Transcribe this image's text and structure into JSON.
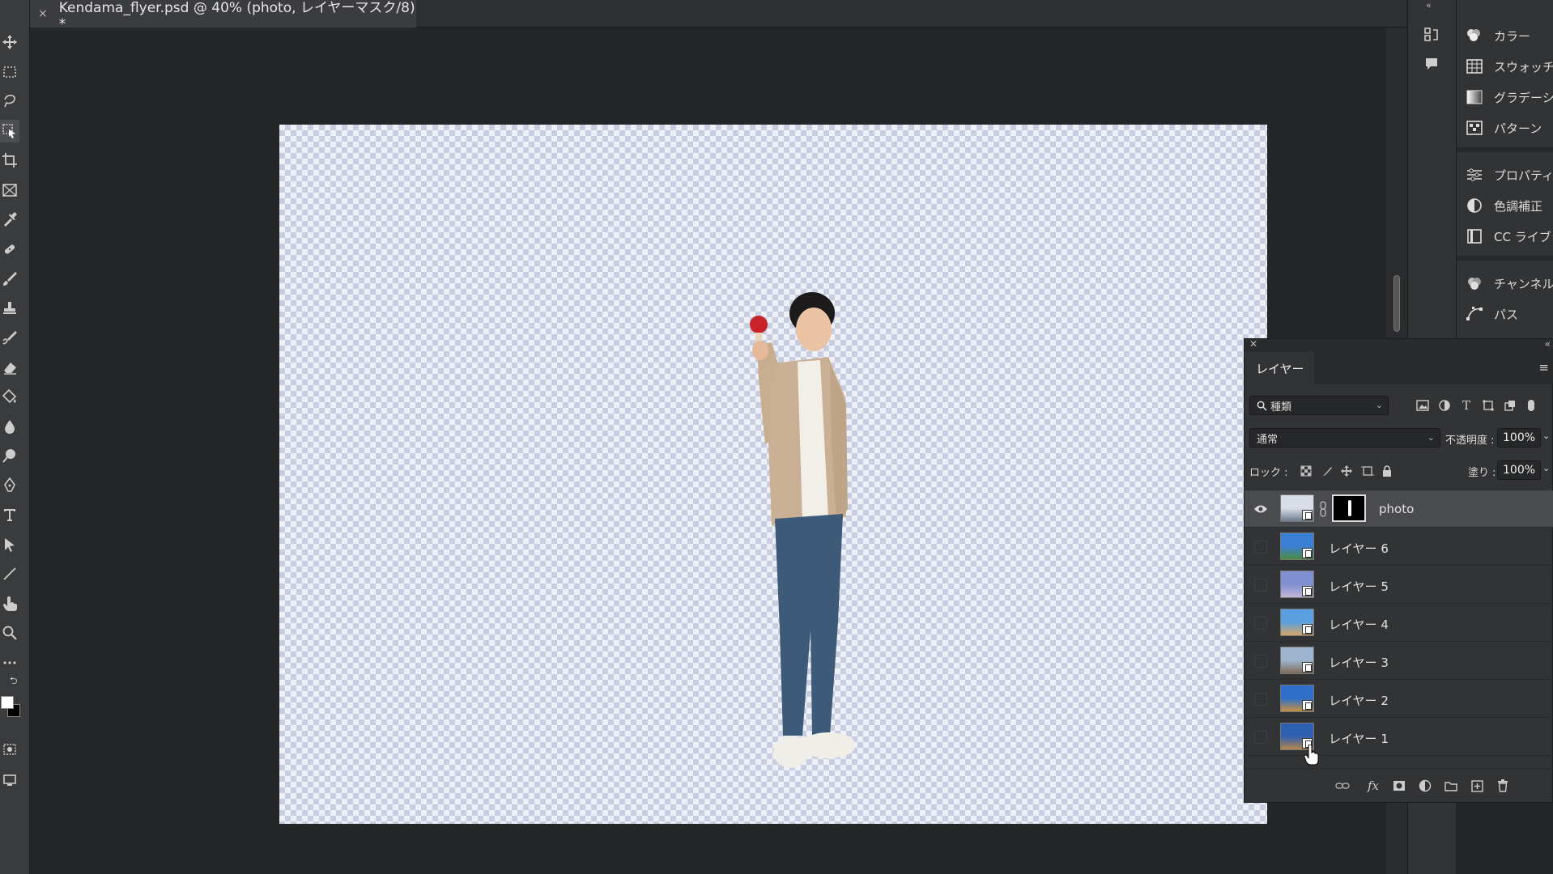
{
  "document_tab": {
    "close_glyph": "×",
    "title": "Kendama_flyer.psd @ 40% (photo, レイヤーマスク/8) *"
  },
  "toolbar": {
    "tools": [
      "move-tool-icon",
      "marquee-tool-icon",
      "lasso-tool-icon",
      "object-select-tool-icon",
      "crop-tool-icon",
      "frame-tool-icon",
      "eyedropper-tool-icon",
      "healing-brush-icon",
      "brush-tool-icon",
      "clone-stamp-icon",
      "history-brush-icon",
      "eraser-tool-icon",
      "paint-bucket-icon",
      "blur-tool-icon",
      "dodge-tool-icon",
      "pen-tool-icon",
      "type-tool-icon",
      "path-select-icon",
      "line-tool-icon",
      "hand-tool-icon",
      "zoom-tool-icon",
      "more-tools-icon"
    ],
    "foreground_color": "#ffffff",
    "background_color": "#000000"
  },
  "right_panels": {
    "items": [
      {
        "icon": "color-icon",
        "label": "カラー"
      },
      {
        "icon": "swatches-icon",
        "label": "スウォッチ"
      },
      {
        "icon": "gradient-icon",
        "label": "グラデーション"
      },
      {
        "icon": "pattern-icon",
        "label": "パターン"
      },
      {
        "icon": "properties-icon",
        "label": "プロパティ"
      },
      {
        "icon": "adjustments-icon",
        "label": "色調補正"
      },
      {
        "icon": "cc-libraries-icon",
        "label": "CC ライブラリ"
      },
      {
        "icon": "channels-icon",
        "label": "チャンネル"
      },
      {
        "icon": "paths-icon",
        "label": "パス"
      }
    ]
  },
  "layers_panel": {
    "tab_label": "レイヤー",
    "filter_label": "種類",
    "blend_mode": "通常",
    "opacity_label": "不透明度 :",
    "opacity_value": "100%",
    "lock_label": "ロック :",
    "fill_label": "塗り :",
    "fill_value": "100%",
    "layers": [
      {
        "name": "photo",
        "visible": true,
        "selected": true,
        "has_mask": true,
        "thumb": [
          "#d9dde8",
          "#6c7b8f"
        ]
      },
      {
        "name": "レイヤー 6",
        "visible": false,
        "selected": false,
        "has_mask": false,
        "thumb": [
          "#3a7fd6",
          "#4c8b3c"
        ]
      },
      {
        "name": "レイヤー 5",
        "visible": false,
        "selected": false,
        "has_mask": false,
        "thumb": [
          "#7f8fd0",
          "#c5b7d8"
        ]
      },
      {
        "name": "レイヤー 4",
        "visible": false,
        "selected": false,
        "has_mask": false,
        "thumb": [
          "#5aa0e0",
          "#d9a461"
        ]
      },
      {
        "name": "レイヤー 3",
        "visible": false,
        "selected": false,
        "has_mask": false,
        "thumb": [
          "#9fb4cf",
          "#7d6b55"
        ]
      },
      {
        "name": "レイヤー 2",
        "visible": false,
        "selected": false,
        "has_mask": false,
        "thumb": [
          "#2d6fc9",
          "#c9903f"
        ]
      },
      {
        "name": "レイヤー 1",
        "visible": false,
        "selected": false,
        "has_mask": false,
        "thumb": [
          "#2e5fb0",
          "#b7874a"
        ]
      }
    ]
  }
}
